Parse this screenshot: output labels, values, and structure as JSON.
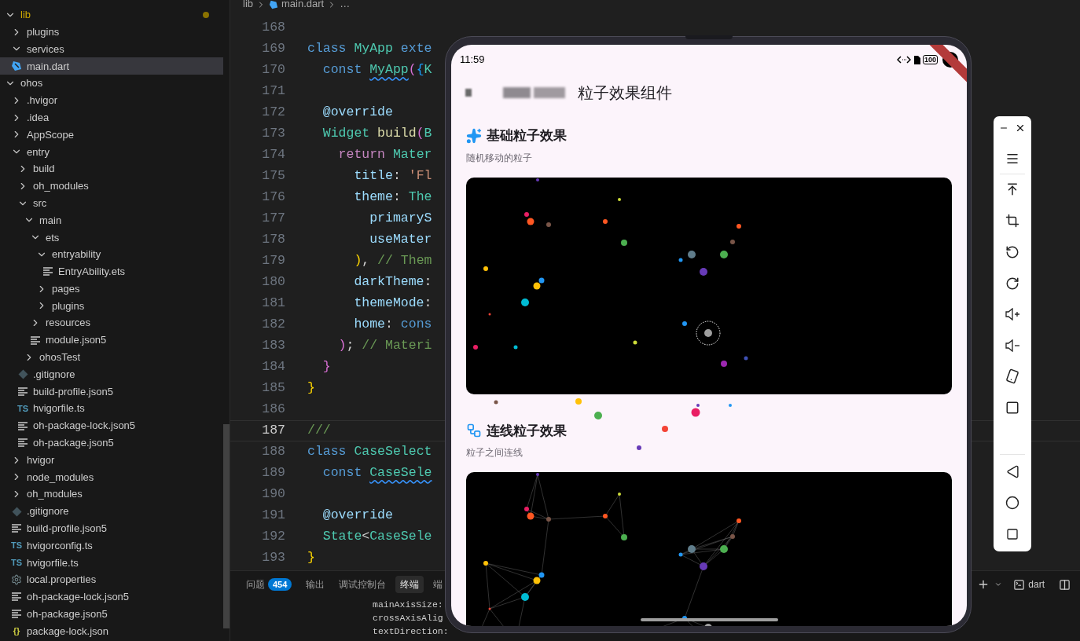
{
  "explorer": {
    "tree": [
      {
        "label": "lib",
        "expanded": true,
        "modified": true,
        "selected": false,
        "children": [
          {
            "label": "plugins",
            "expanded": false,
            "modified": false,
            "selected": false
          },
          {
            "label": "services",
            "expanded": true,
            "modified": false,
            "selected": false
          },
          {
            "label": "main.dart",
            "kind": "dart",
            "modified": false,
            "selected": true
          }
        ]
      },
      {
        "label": "ohos",
        "expanded": true,
        "modified": false,
        "selected": false,
        "children": [
          {
            "label": ".hvigor",
            "expanded": false,
            "modified": false,
            "selected": false
          },
          {
            "label": ".idea",
            "expanded": false,
            "modified": false,
            "selected": false
          },
          {
            "label": "AppScope",
            "expanded": false,
            "modified": false,
            "selected": false
          },
          {
            "label": "entry",
            "expanded": true,
            "modified": false,
            "selected": false,
            "children": [
              {
                "label": "build",
                "expanded": false,
                "modified": false,
                "selected": false
              },
              {
                "label": "oh_modules",
                "expanded": false,
                "modified": false,
                "selected": false
              },
              {
                "label": "src",
                "expanded": true,
                "modified": false,
                "selected": false,
                "children": [
                  {
                    "label": "main",
                    "expanded": true,
                    "modified": false,
                    "selected": false,
                    "children": [
                      {
                        "label": "ets",
                        "expanded": true,
                        "modified": false,
                        "selected": false,
                        "children": [
                          {
                            "label": "entryability",
                            "expanded": true,
                            "modified": false,
                            "selected": false,
                            "children": [
                              {
                                "label": "EntryAbility.ets",
                                "kind": "text",
                                "modified": false,
                                "selected": false
                              }
                            ]
                          },
                          {
                            "label": "pages",
                            "expanded": false,
                            "modified": false,
                            "selected": false
                          },
                          {
                            "label": "plugins",
                            "expanded": false,
                            "modified": false,
                            "selected": false
                          }
                        ]
                      },
                      {
                        "label": "resources",
                        "expanded": false,
                        "modified": false,
                        "selected": false
                      },
                      {
                        "label": "module.json5",
                        "kind": "text",
                        "modified": false,
                        "selected": false
                      }
                    ]
                  },
                  {
                    "label": "ohosTest",
                    "expanded": false,
                    "modified": false,
                    "selected": false
                  }
                ]
              },
              {
                "label": ".gitignore",
                "kind": "git",
                "modified": false,
                "selected": false
              },
              {
                "label": "build-profile.json5",
                "kind": "text",
                "modified": false,
                "selected": false
              },
              {
                "label": "hvigorfile.ts",
                "kind": "ts",
                "badge": "TS",
                "modified": false,
                "selected": false
              },
              {
                "label": "oh-package-lock.json5",
                "kind": "text",
                "modified": false,
                "selected": false
              },
              {
                "label": "oh-package.json5",
                "kind": "text",
                "modified": false,
                "selected": false
              }
            ]
          },
          {
            "label": "hvigor",
            "expanded": false,
            "modified": false,
            "selected": false
          },
          {
            "label": "node_modules",
            "expanded": false,
            "modified": false,
            "selected": false
          },
          {
            "label": "oh_modules",
            "expanded": false,
            "modified": false,
            "selected": false
          },
          {
            "label": ".gitignore",
            "kind": "git",
            "modified": false,
            "selected": false
          },
          {
            "label": "build-profile.json5",
            "kind": "text",
            "modified": false,
            "selected": false
          },
          {
            "label": "hvigorconfig.ts",
            "kind": "ts",
            "badge": "TS",
            "modified": false,
            "selected": false
          },
          {
            "label": "hvigorfile.ts",
            "kind": "ts",
            "badge": "TS",
            "modified": false,
            "selected": false
          },
          {
            "label": "local.properties",
            "kind": "settings",
            "modified": false,
            "selected": false
          },
          {
            "label": "oh-package-lock.json5",
            "kind": "text",
            "modified": false,
            "selected": false
          },
          {
            "label": "oh-package.json5",
            "kind": "text",
            "modified": false,
            "selected": false
          },
          {
            "label": "package-lock.json",
            "kind": "json",
            "badge": "{}",
            "modified": false,
            "selected": false
          }
        ]
      }
    ]
  },
  "breadcrumb": [
    {
      "label": "lib",
      "kind": "folder"
    },
    {
      "label": "main.dart",
      "kind": "dart"
    },
    {
      "label": "…",
      "kind": "more"
    }
  ],
  "editor": {
    "lines": [
      {
        "number": "168",
        "selected": false
      },
      {
        "number": "169",
        "selected": false,
        "tokens": [
          {
            "text": "class",
            "kind": "keyword"
          },
          {
            "text": " MyApp",
            "kind": "type"
          },
          {
            "text": " exte",
            "kind": "keyword"
          }
        ]
      },
      {
        "number": "170",
        "selected": false,
        "tokens": [
          {
            "text": "  const ",
            "kind": "keyword"
          },
          {
            "text": "MyApp",
            "kind": "type",
            "warning": true
          },
          {
            "text": "(",
            "kind": "bracket2"
          },
          {
            "text": "{",
            "kind": "bracket3"
          },
          {
            "text": "K",
            "kind": "type"
          }
        ]
      },
      {
        "number": "171",
        "selected": false
      },
      {
        "number": "172",
        "selected": false,
        "tokens": [
          {
            "text": "  @override",
            "kind": "prop"
          }
        ]
      },
      {
        "number": "173",
        "selected": false,
        "tokens": [
          {
            "text": "  Widget",
            "kind": "type"
          },
          {
            "text": " build",
            "kind": "func"
          },
          {
            "text": "(",
            "kind": "bracket2"
          },
          {
            "text": "B",
            "kind": "type"
          }
        ]
      },
      {
        "number": "174",
        "selected": false,
        "tokens": [
          {
            "text": "    return",
            "kind": "control"
          },
          {
            "text": " Mater",
            "kind": "type"
          }
        ]
      },
      {
        "number": "175",
        "selected": false,
        "tokens": [
          {
            "text": "      title",
            "kind": "prop"
          },
          {
            "text": ": "
          },
          {
            "text": "'Fl",
            "kind": "string"
          }
        ]
      },
      {
        "number": "176",
        "selected": false,
        "tokens": [
          {
            "text": "      theme",
            "kind": "prop"
          },
          {
            "text": ": "
          },
          {
            "text": "The",
            "kind": "type"
          }
        ]
      },
      {
        "number": "177",
        "selected": false,
        "tokens": [
          {
            "text": "        primaryS",
            "kind": "prop"
          }
        ]
      },
      {
        "number": "178",
        "selected": false,
        "tokens": [
          {
            "text": "        useMater",
            "kind": "prop"
          }
        ]
      },
      {
        "number": "179",
        "selected": false,
        "tokens": [
          {
            "text": "      )",
            "kind": "bracket1"
          },
          {
            "text": ","
          },
          {
            "text": " // Them",
            "kind": "comment"
          }
        ]
      },
      {
        "number": "180",
        "selected": false,
        "tokens": [
          {
            "text": "      darkTheme",
            "kind": "prop"
          },
          {
            "text": ":"
          }
        ]
      },
      {
        "number": "181",
        "selected": false,
        "tokens": [
          {
            "text": "      themeMode",
            "kind": "prop"
          },
          {
            "text": ":"
          }
        ]
      },
      {
        "number": "182",
        "selected": false,
        "tokens": [
          {
            "text": "      home",
            "kind": "prop"
          },
          {
            "text": ": "
          },
          {
            "text": "cons",
            "kind": "keyword"
          }
        ]
      },
      {
        "number": "183",
        "selected": false,
        "tokens": [
          {
            "text": "    )",
            "kind": "bracket2"
          },
          {
            "text": ";"
          },
          {
            "text": " // Materi",
            "kind": "comment"
          }
        ]
      },
      {
        "number": "184",
        "selected": false,
        "tokens": [
          {
            "text": "  }",
            "kind": "bracket2"
          }
        ]
      },
      {
        "number": "185",
        "selected": false,
        "tokens": [
          {
            "text": "}",
            "kind": "bracket1"
          }
        ]
      },
      {
        "number": "186",
        "selected": false
      },
      {
        "number": "187",
        "selected": true,
        "tokens": [
          {
            "text": "///",
            "kind": "comment"
          }
        ]
      },
      {
        "number": "188",
        "selected": false,
        "tokens": [
          {
            "text": "class",
            "kind": "keyword"
          },
          {
            "text": " CaseSelect",
            "kind": "type"
          }
        ]
      },
      {
        "number": "189",
        "selected": false,
        "tokens": [
          {
            "text": "  const ",
            "kind": "keyword"
          },
          {
            "text": "CaseSele",
            "kind": "type",
            "warning": true
          }
        ]
      },
      {
        "number": "190",
        "selected": false
      },
      {
        "number": "191",
        "selected": false,
        "tokens": [
          {
            "text": "  @override",
            "kind": "prop"
          }
        ]
      },
      {
        "number": "192",
        "selected": false,
        "tokens": [
          {
            "text": "  State",
            "kind": "type"
          },
          {
            "text": "<"
          },
          {
            "text": "CaseSele",
            "kind": "type"
          }
        ]
      },
      {
        "number": "193",
        "selected": false,
        "tokens": [
          {
            "text": "}",
            "kind": "bracket1"
          }
        ]
      }
    ]
  },
  "panel": {
    "tabs": [
      {
        "label": "问题",
        "badge": "454",
        "selected": false
      },
      {
        "label": "输出",
        "selected": false
      },
      {
        "label": "调试控制台",
        "selected": false
      },
      {
        "label": "终端",
        "selected": true
      },
      {
        "label": "端",
        "selected": false
      }
    ],
    "terminal_lines": [
      "mainAxisSize:",
      "crossAxisAlig",
      "textDirection:"
    ],
    "terminal_name": "dart"
  },
  "phone": {
    "status_bar": {
      "time": "11:59",
      "battery": "100"
    },
    "app_bar": {
      "title": "粒子效果组件"
    },
    "sections": [
      {
        "kind": "basic",
        "title": "基础粒子效果",
        "subtitle": "随机移动的粒子"
      },
      {
        "kind": "connected",
        "title": "连线粒子效果",
        "subtitle": "粒子之间连线"
      }
    ]
  }
}
